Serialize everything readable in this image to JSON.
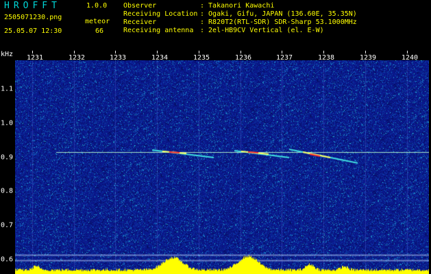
{
  "app": {
    "title": "HROFFT",
    "version": "1.0.0"
  },
  "file": {
    "name": "2505071230.png",
    "datetime": "25.05.07 12:30"
  },
  "meteor": {
    "label": "meteor",
    "count": "66"
  },
  "station": {
    "observer_label": "Observer",
    "observer": ": Takanori Kawachi",
    "location_label": "Receiving Location",
    "location": ": Ogaki, Gifu, JAPAN (136.60E, 35.35N)",
    "receiver_label": "Receiver",
    "receiver": ": R820T2(RTL-SDR) SDR-Sharp 53.1000MHz",
    "antenna_label": "Receiving antenna",
    "antenna": ": 2el-HB9CV Vertical (el. E-W)"
  },
  "axes": {
    "y_unit": "kHz",
    "x_ticks": [
      "1231",
      "1232",
      "1233",
      "1234",
      "1235",
      "1236",
      "1237",
      "1238",
      "1239",
      "1240"
    ],
    "y_ticks": [
      "1.1",
      "1.0",
      "0.9",
      "0.8",
      "0.7",
      "0.6"
    ]
  },
  "colors": {
    "background": "#0a1690",
    "label_cyan": "#00d8d8",
    "signal_yellow": "#ffff00",
    "echo_red": "#ff3030"
  }
}
